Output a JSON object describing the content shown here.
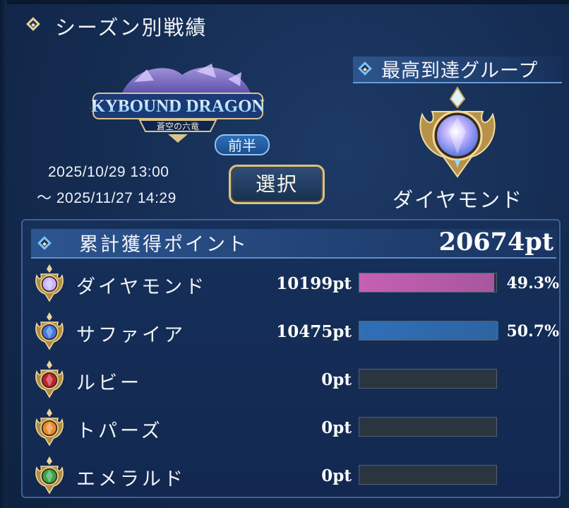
{
  "header": {
    "title": "シーズン別戦績"
  },
  "season": {
    "logo_title": "SKYBOUND DRAGONS",
    "logo_subtitle": "蒼空の六竜",
    "half": "前半",
    "date_start": "2025/10/29 13:00",
    "date_end": "〜 2025/11/27 14:29",
    "select_label": "選択"
  },
  "best_group": {
    "label": "最高到達グループ",
    "name": "ダイヤモンド",
    "icon": "diamond-gem-icon"
  },
  "totals": {
    "label": "累計獲得ポイント",
    "value": "20674pt"
  },
  "groups": [
    {
      "name": "ダイヤモンド",
      "points": "10199pt",
      "percent": "49.3%",
      "fill": 0.493,
      "color": "#c65fb4",
      "icon": "diamond-gem-icon"
    },
    {
      "name": "サファイア",
      "points": "10475pt",
      "percent": "50.7%",
      "fill": 0.507,
      "color": "#2f6fb8",
      "icon": "sapphire-gem-icon"
    },
    {
      "name": "ルビー",
      "points": "0pt",
      "percent": "",
      "fill": 0,
      "color": "#c0392b",
      "icon": "ruby-gem-icon"
    },
    {
      "name": "トパーズ",
      "points": "0pt",
      "percent": "",
      "fill": 0,
      "color": "#e0892a",
      "icon": "topaz-gem-icon"
    },
    {
      "name": "エメラルド",
      "points": "0pt",
      "percent": "",
      "fill": 0,
      "color": "#3aa34a",
      "icon": "emerald-gem-icon"
    }
  ]
}
